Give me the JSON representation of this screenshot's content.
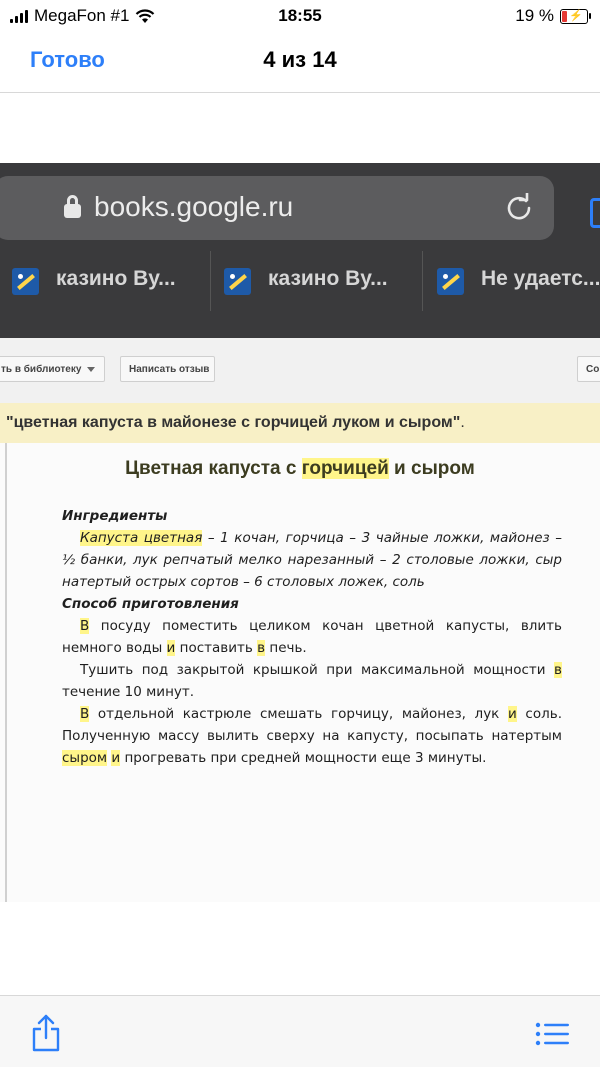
{
  "status_bar": {
    "carrier": "MegaFon #1",
    "time": "18:55",
    "battery": "19 %",
    "battery_level": 0.19
  },
  "viewer": {
    "done_label": "Готово",
    "counter": "4 из 14"
  },
  "browser": {
    "url": "books.google.ru",
    "tabs": [
      {
        "label": "казино Ву..."
      },
      {
        "label": "казино Ву..."
      },
      {
        "label": "Не удаетс..."
      }
    ]
  },
  "books_toolbar": {
    "library_button": "ть в библиотеку",
    "review_button": "Написать отзыв",
    "right_button": "Со"
  },
  "search_banner": {
    "query": "\"цветная капуста в майонезе с горчицей луком и сыром\"",
    "tail": "."
  },
  "page": {
    "title_parts": [
      "Цветная капуста с ",
      "горчицей",
      " и сыром"
    ],
    "ingredients_heading": "Ингредиенты",
    "ingredients_highlight": "Капуста цветная",
    "ingredients_text": " – 1 кочан, горчица – 3 чайные ложки, майонез – ½ банки, лук репчатый мелко нарезанный – 2 столовые ложки, сыр натертый острых сортов – 6 столовых ложек, соль",
    "method_heading": "Способ приготовления",
    "p1": [
      "В",
      " посуду поместить целиком кочан цветной капусты, влить немного воды ",
      "и",
      " поставить ",
      "в",
      " печь."
    ],
    "p2": [
      "Тушить под закрытой крышкой при максимальной мощности ",
      "в",
      " течение 10 минут."
    ],
    "p3": [
      "В",
      " отдельной кастрюле смешать горчицу, майонез, лук ",
      "и",
      " соль. Полученную массу вылить сверху на капусту, посыпать натертым ",
      "сыром",
      " ",
      "и",
      " прогревать при средней мощности еще 3 минуты."
    ]
  },
  "colors": {
    "accent": "#2d7ff9",
    "highlight": "#fff58a",
    "banner": "#f8f0c6",
    "browser_chrome": "#3a3a3c"
  },
  "icons": {
    "share": "share-icon",
    "list": "list-icon",
    "lock": "lock-icon",
    "reload": "reload-icon"
  }
}
